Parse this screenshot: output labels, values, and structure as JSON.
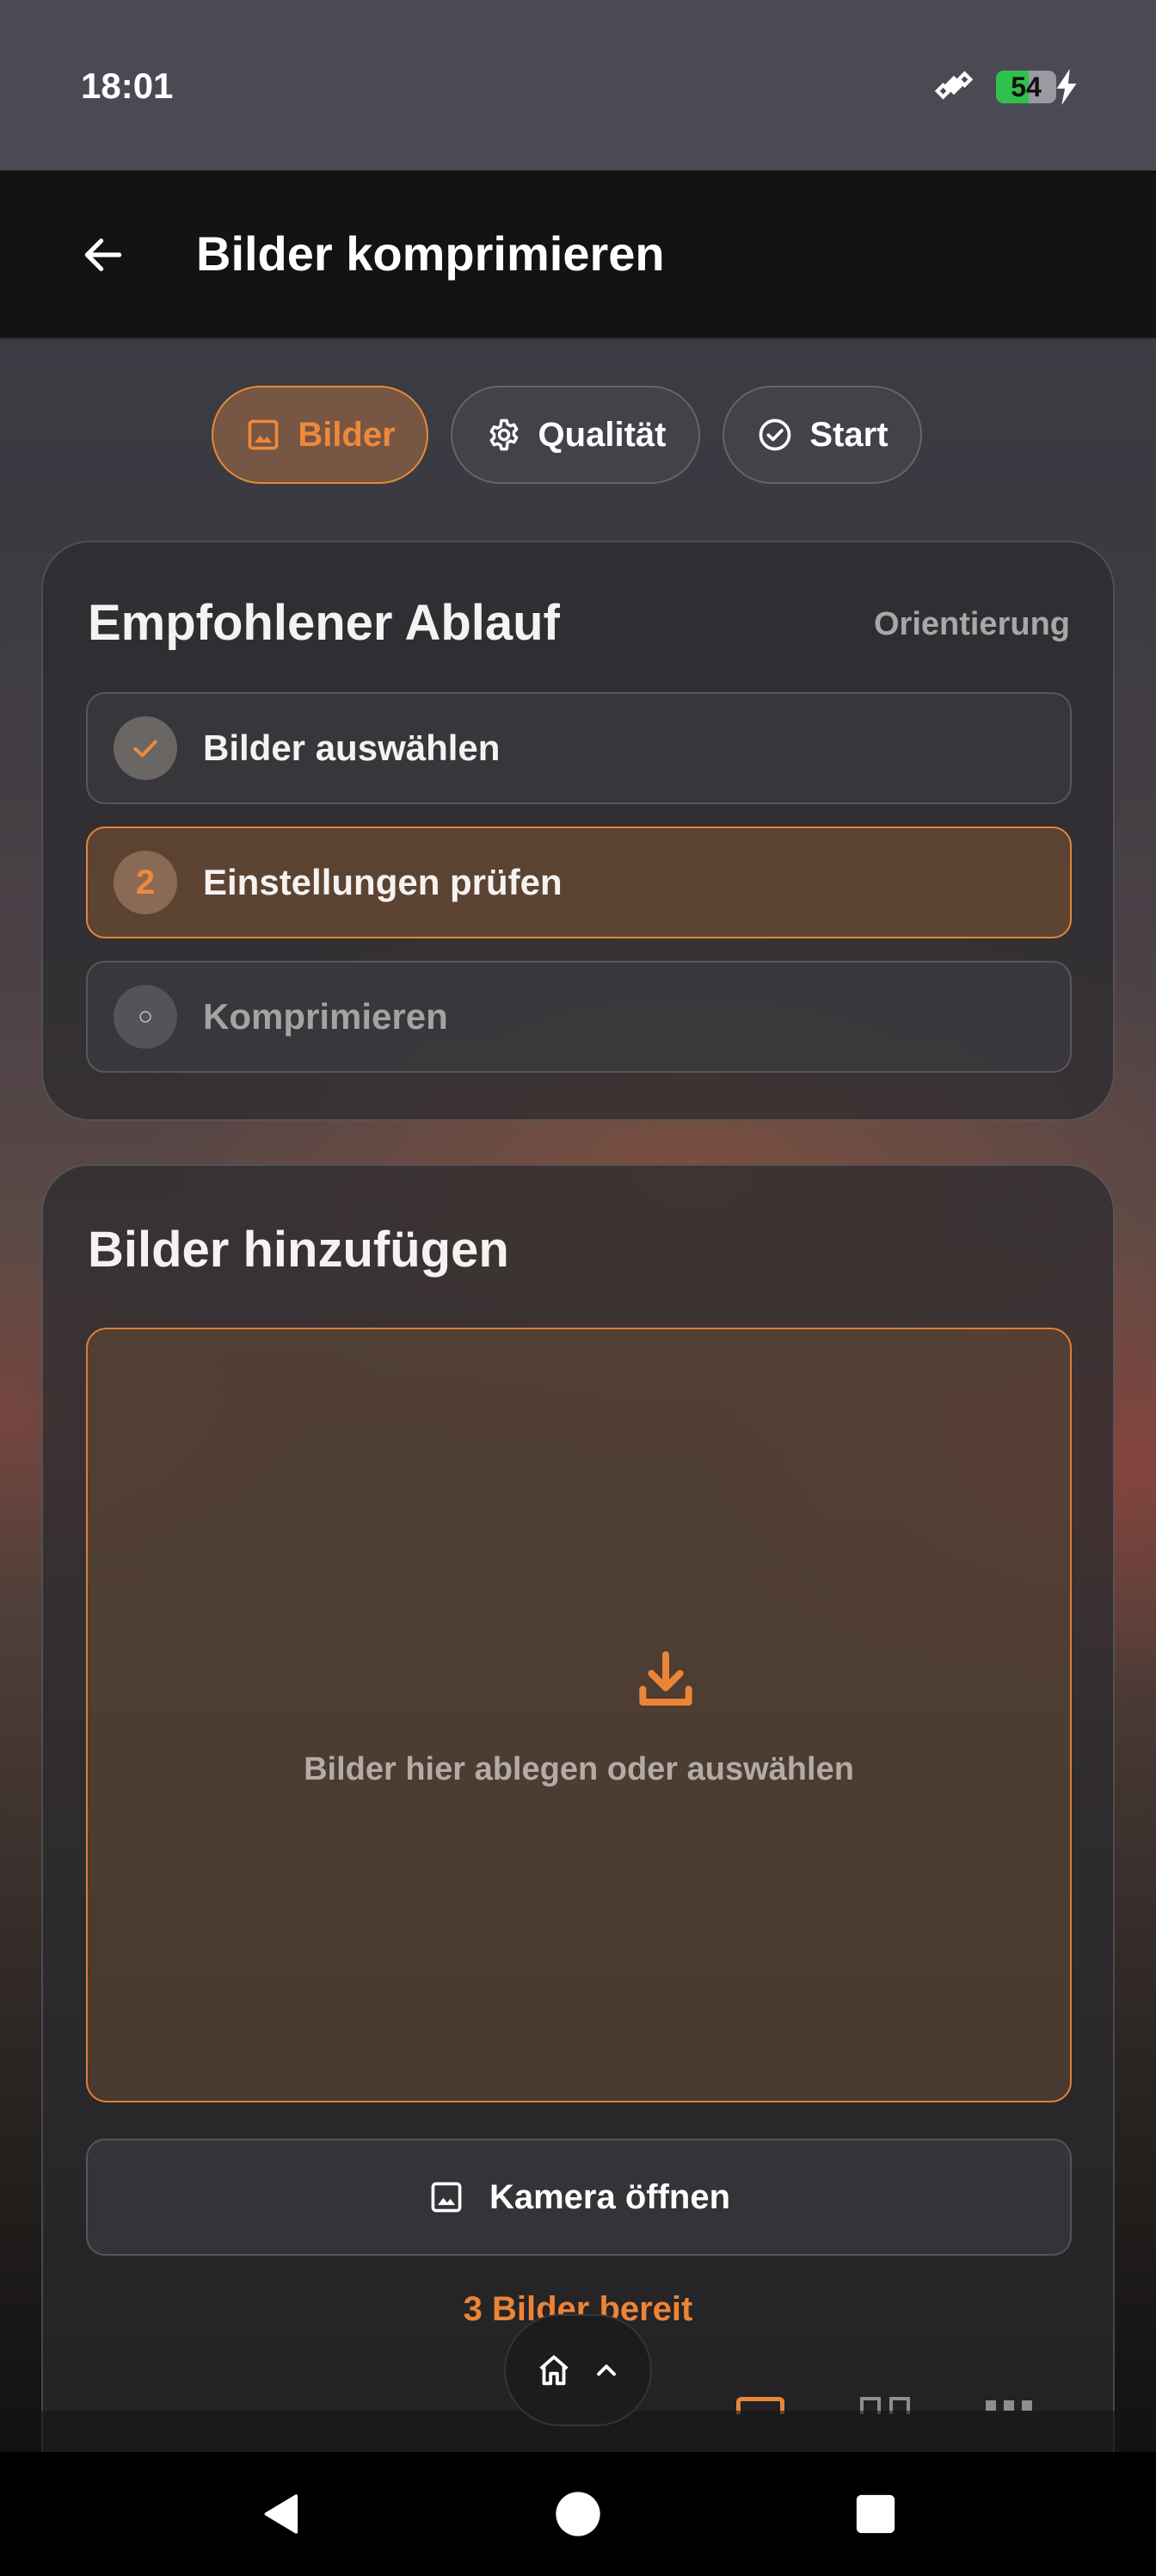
{
  "status_bar": {
    "time": "18:01",
    "battery_level": "54",
    "battery_percent": 54,
    "icons": [
      "satellite-icon",
      "battery-icon",
      "charging-bolt-icon"
    ]
  },
  "app_bar": {
    "title": "Bilder komprimieren",
    "back_icon": "arrow-left-icon"
  },
  "tabs": [
    {
      "label": "Bilder",
      "icon": "image-icon",
      "active": true
    },
    {
      "label": "Qualität",
      "icon": "gear-icon",
      "active": false
    },
    {
      "label": "Start",
      "icon": "check-circle-icon",
      "active": false
    }
  ],
  "workflow": {
    "title": "Empfohlener Ablauf",
    "tag": "Orientierung",
    "steps": [
      {
        "marker": "✓",
        "label": "Bilder auswählen",
        "state": "done"
      },
      {
        "marker": "2",
        "label": "Einstellungen prüfen",
        "state": "current"
      },
      {
        "marker": "○",
        "label": "Komprimieren",
        "state": "pending"
      }
    ]
  },
  "add_images": {
    "title": "Bilder hinzufügen",
    "dropzone_text": "Bilder hier ablegen oder auswählen",
    "camera_label": "Kamera öffnen",
    "ready_text": "3 Bilder bereit"
  },
  "colors": {
    "accent": "#E8863A",
    "app_bar": "#131313",
    "status_bar": "#4A4A55",
    "battery_fill": "#2FC14B"
  }
}
